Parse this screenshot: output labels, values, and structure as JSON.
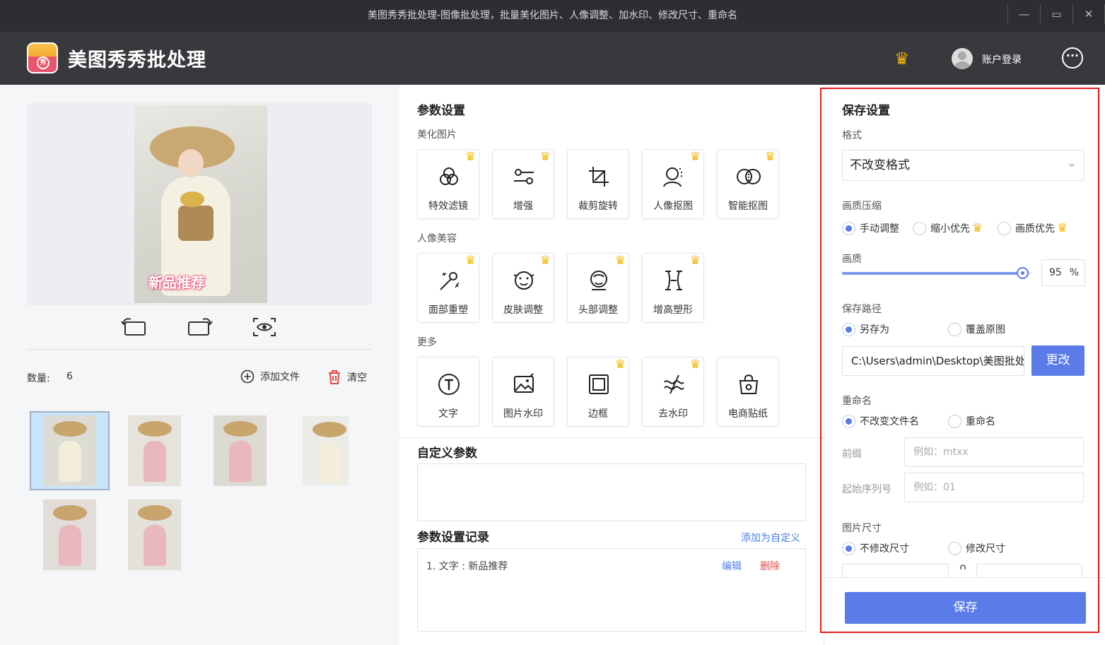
{
  "window": {
    "title": "美图秀秀批处理-图像批处理，批量美化图片、人像调整、加水印、修改尺寸、重命名",
    "min": "—",
    "max": "▭",
    "close": "✕"
  },
  "header": {
    "app_name": "美图秀秀批处理",
    "logo_text": "秀",
    "login": "账户登录",
    "vip_icon": "crown-icon",
    "more_icon": "ellipsis-icon",
    "crown_glyph": "♛",
    "more_glyph": "···"
  },
  "left": {
    "watermark": "新品推荐",
    "count_label": "数量:",
    "count_value": "6",
    "add_file": "添加文件",
    "clear": "清空",
    "thumbs": [
      {
        "selected": true,
        "tone": "cream"
      },
      {
        "selected": false,
        "tone": "pink"
      },
      {
        "selected": false,
        "tone": "pink"
      },
      {
        "selected": false,
        "tone": "cream"
      },
      {
        "selected": false,
        "tone": "pink"
      },
      {
        "selected": false,
        "tone": "pink"
      }
    ]
  },
  "params": {
    "title": "参数设置",
    "group_beautify": "美化图片",
    "group_portrait": "人像美容",
    "group_more": "更多",
    "beautify": [
      {
        "label": "特效滤镜",
        "icon": "filter-icon",
        "vip": true
      },
      {
        "label": "增强",
        "icon": "enhance-icon",
        "vip": true
      },
      {
        "label": "裁剪旋转",
        "icon": "crop-icon",
        "vip": false
      },
      {
        "label": "人像抠图",
        "icon": "portrait-cutout-icon",
        "vip": true
      },
      {
        "label": "智能抠图",
        "icon": "smart-cutout-icon",
        "vip": true
      }
    ],
    "portrait": [
      {
        "label": "面部重塑",
        "icon": "magic-wand-icon",
        "vip": true
      },
      {
        "label": "皮肤调整",
        "icon": "skin-icon",
        "vip": true
      },
      {
        "label": "头部调整",
        "icon": "head-icon",
        "vip": true
      },
      {
        "label": "增高塑形",
        "icon": "body-shape-icon",
        "vip": true
      }
    ],
    "more": [
      {
        "label": "文字",
        "icon": "text-icon",
        "vip": false
      },
      {
        "label": "图片水印",
        "icon": "image-watermark-icon",
        "vip": false
      },
      {
        "label": "边框",
        "icon": "border-icon",
        "vip": true
      },
      {
        "label": "去水印",
        "icon": "remove-watermark-icon",
        "vip": true
      },
      {
        "label": "电商贴纸",
        "icon": "sticker-icon",
        "vip": false
      }
    ],
    "custom_title": "自定义参数",
    "record_title": "参数设置记录",
    "add_custom": "添加为自定义",
    "records": [
      {
        "text": "1.  文字 : 新品推荐",
        "edit": "编辑",
        "delete": "删除"
      }
    ]
  },
  "save": {
    "title": "保存设置",
    "format_label": "格式",
    "format_value": "不改变格式",
    "compress_label": "画质压缩",
    "compress_options": [
      {
        "label": "手动调整",
        "checked": true,
        "vip": false
      },
      {
        "label": "缩小优先",
        "checked": false,
        "vip": true
      },
      {
        "label": "画质优先",
        "checked": false,
        "vip": true
      }
    ],
    "quality_label": "画质",
    "quality_value": 95,
    "quality_value_text": "95",
    "quality_unit": "%",
    "path_label": "保存路径",
    "path_options": [
      {
        "label": "另存为",
        "checked": true
      },
      {
        "label": "覆盖原图",
        "checked": false
      }
    ],
    "path_value": "C:\\Users\\admin\\Desktop\\美图批处理",
    "change_button": "更改",
    "rename_label": "重命名",
    "rename_options": [
      {
        "label": "不改变文件名",
        "checked": true
      },
      {
        "label": "重命名",
        "checked": false
      }
    ],
    "prefix_label": "前缀",
    "prefix_placeholder": "例如：mtxx",
    "start_label": "起始序列号",
    "start_placeholder": "例如：01",
    "size_label": "图片尺寸",
    "size_options": [
      {
        "label": "不修改尺寸",
        "checked": true
      },
      {
        "label": "修改尺寸",
        "checked": false
      }
    ],
    "save_button": "保存"
  },
  "colors": {
    "accent": "#5b7ce8",
    "vip": "#f5b80a",
    "danger": "#e24a4a",
    "link": "#4a7ee8",
    "highlight_frame": "#e21a1a"
  }
}
